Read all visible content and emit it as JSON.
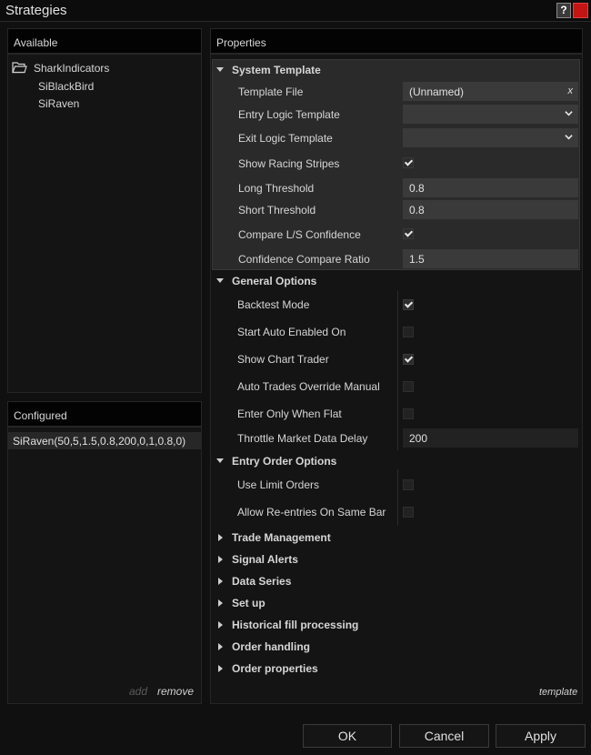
{
  "window": {
    "title": "Strategies"
  },
  "available": {
    "header": "Available",
    "tree": {
      "folder": "SharkIndicators",
      "children": [
        "SiBlackBird",
        "SiRaven"
      ]
    }
  },
  "configured": {
    "header": "Configured",
    "items": [
      "SiRaven(50,5,1.5,0.8,200,0,1,0.8,0)"
    ],
    "add_label": "add",
    "remove_label": "remove"
  },
  "properties": {
    "header": "Properties",
    "system_template": {
      "label": "System Template",
      "template_file": {
        "label": "Template File",
        "value": "(Unnamed)",
        "clear": "x"
      },
      "entry_logic": {
        "label": "Entry Logic Template",
        "value": ""
      },
      "exit_logic": {
        "label": "Exit Logic Template",
        "value": ""
      },
      "show_racing_stripes": {
        "label": "Show Racing Stripes",
        "checked": true
      },
      "long_threshold": {
        "label": "Long Threshold",
        "value": "0.8"
      },
      "short_threshold": {
        "label": "Short Threshold",
        "value": "0.8"
      },
      "compare_confidence": {
        "label": "Compare L/S Confidence",
        "checked": true
      },
      "confidence_ratio": {
        "label": "Confidence Compare Ratio",
        "value": "1.5"
      }
    },
    "general_options": {
      "label": "General Options",
      "backtest_mode": {
        "label": "Backtest Mode",
        "checked": true
      },
      "start_auto_enabled": {
        "label": "Start Auto Enabled On",
        "checked": false
      },
      "show_chart_trader": {
        "label": "Show Chart Trader",
        "checked": true
      },
      "auto_trades_override": {
        "label": "Auto Trades Override Manual",
        "checked": false
      },
      "enter_only_flat": {
        "label": "Enter Only When Flat",
        "checked": false
      },
      "throttle_delay": {
        "label": "Throttle Market Data Delay",
        "value": "200"
      }
    },
    "entry_order_options": {
      "label": "Entry Order Options",
      "use_limit_orders": {
        "label": "Use Limit Orders",
        "checked": false
      },
      "allow_reentries": {
        "label": "Allow Re-entries On Same Bar",
        "checked": false
      }
    },
    "collapsed": [
      "Trade Management",
      "Signal Alerts",
      "Data Series",
      "Set up",
      "Historical fill processing",
      "Order handling",
      "Order properties"
    ],
    "template_link": "template"
  },
  "buttons": {
    "ok": "OK",
    "cancel": "Cancel",
    "apply": "Apply"
  },
  "icons": [
    "help-icon",
    "close-icon",
    "folder-icon",
    "chevron-down-icon",
    "triangle-down-icon",
    "triangle-right-icon",
    "checkmark-icon"
  ],
  "colors": {
    "close": "#c41414",
    "panel": "#141414",
    "group": "#2a2a2a",
    "field": "#3a3a3a"
  }
}
